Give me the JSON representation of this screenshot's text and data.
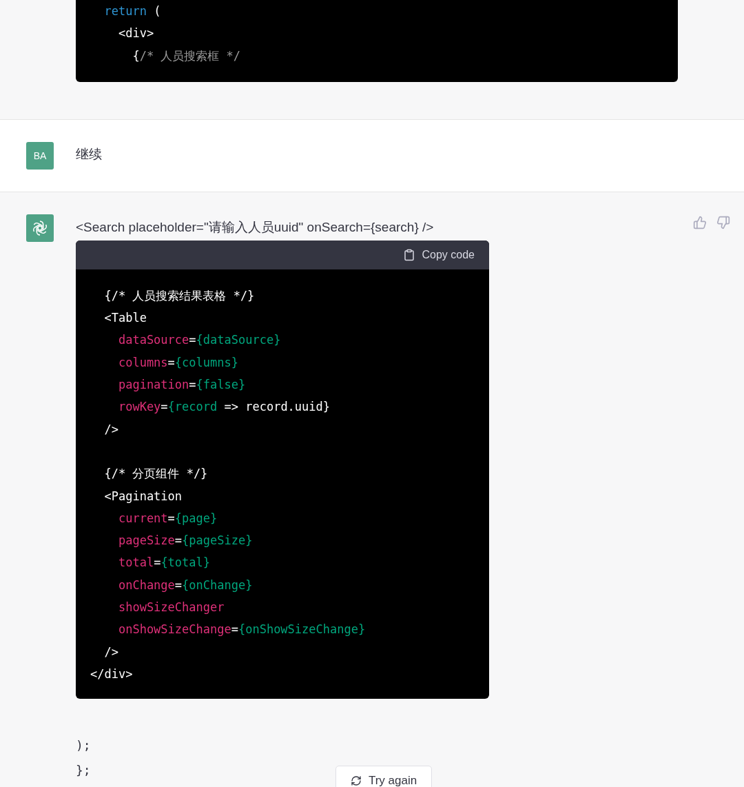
{
  "previous_code": {
    "lines": [
      [
        {
          "kind": "keyword",
          "text": "  return"
        },
        {
          "kind": "plain",
          "text": " ("
        }
      ],
      [
        {
          "kind": "plain",
          "text": "    <div>"
        }
      ],
      [
        {
          "kind": "plain",
          "text": "      {"
        },
        {
          "kind": "comment",
          "text": "/* 人员搜索框 */"
        }
      ]
    ]
  },
  "user_message": {
    "avatar": "BA",
    "text": "继续"
  },
  "assistant_message": {
    "text": "<Search placeholder=\"请输入人员uuid\" onSearch={search} />",
    "code": {
      "copy_label": "Copy code",
      "lines": [
        [
          {
            "kind": "plain",
            "text": "  {/* 人员搜索结果表格 */}"
          }
        ],
        [
          {
            "kind": "plain",
            "text": "  <Table"
          }
        ],
        [
          {
            "kind": "attr",
            "text": "    dataSource"
          },
          {
            "kind": "plain",
            "text": "="
          },
          {
            "kind": "value",
            "text": "{dataSource}"
          }
        ],
        [
          {
            "kind": "attr",
            "text": "    columns"
          },
          {
            "kind": "plain",
            "text": "="
          },
          {
            "kind": "value",
            "text": "{columns}"
          }
        ],
        [
          {
            "kind": "attr",
            "text": "    pagination"
          },
          {
            "kind": "plain",
            "text": "="
          },
          {
            "kind": "value",
            "text": "{false}"
          }
        ],
        [
          {
            "kind": "attr",
            "text": "    rowKey"
          },
          {
            "kind": "plain",
            "text": "="
          },
          {
            "kind": "value",
            "text": "{record"
          },
          {
            "kind": "plain",
            "text": " => record.uuid}"
          }
        ],
        [
          {
            "kind": "plain",
            "text": "  />"
          }
        ],
        [
          {
            "kind": "blank"
          }
        ],
        [
          {
            "kind": "plain",
            "text": "  {/* 分页组件 */}"
          }
        ],
        [
          {
            "kind": "plain",
            "text": "  <Pagination"
          }
        ],
        [
          {
            "kind": "attr",
            "text": "    current"
          },
          {
            "kind": "plain",
            "text": "="
          },
          {
            "kind": "value",
            "text": "{page}"
          }
        ],
        [
          {
            "kind": "attr",
            "text": "    pageSize"
          },
          {
            "kind": "plain",
            "text": "="
          },
          {
            "kind": "value",
            "text": "{pageSize}"
          }
        ],
        [
          {
            "kind": "attr",
            "text": "    total"
          },
          {
            "kind": "plain",
            "text": "="
          },
          {
            "kind": "value",
            "text": "{total}"
          }
        ],
        [
          {
            "kind": "attr",
            "text": "    onChange"
          },
          {
            "kind": "plain",
            "text": "="
          },
          {
            "kind": "value",
            "text": "{onChange}"
          }
        ],
        [
          {
            "kind": "attr",
            "text": "    showSizeChanger"
          }
        ],
        [
          {
            "kind": "attr",
            "text": "    onShowSizeChange"
          },
          {
            "kind": "plain",
            "text": "="
          },
          {
            "kind": "value",
            "text": "{onShowSizeChange}"
          }
        ],
        [
          {
            "kind": "plain",
            "text": "  />"
          }
        ],
        [
          {
            "kind": "plain",
            "text": "</div>"
          }
        ]
      ]
    },
    "after_lines": [
      ");",
      "};"
    ]
  },
  "try_again": "Try again"
}
